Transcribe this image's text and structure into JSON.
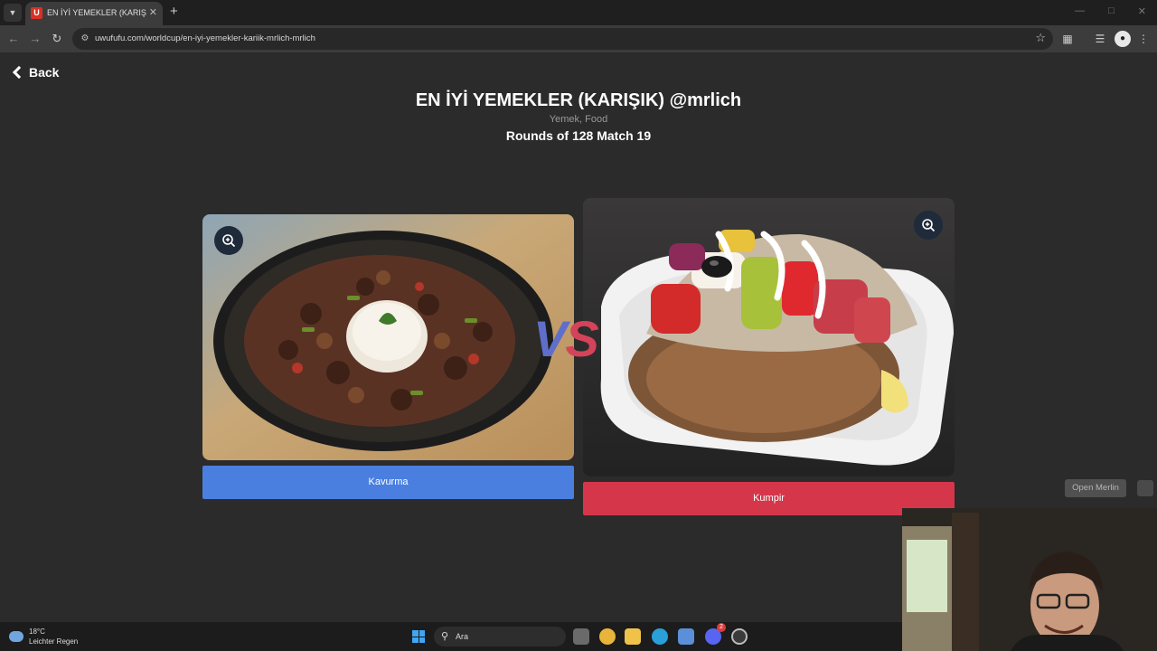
{
  "browser": {
    "tab_title": "EN İYİ YEMEKLER (KARIŞIK) @mrlich",
    "favicon_letter": "U",
    "url": "uwufufu.com/worldcup/en-iyi-yemekler-kariik-mrlich-mrlich"
  },
  "page": {
    "back_label": "Back",
    "title": "EN İYİ YEMEKLER (KARIŞIK) @mrlich",
    "subtitle": "Yemek, Food",
    "round_info": "Rounds of 128 Match 19",
    "vs_v": "V",
    "vs_s": "S"
  },
  "choices": [
    {
      "label": "Kavurma",
      "color": "#4a7fe0"
    },
    {
      "label": "Kumpir",
      "color": "#d5364a"
    }
  ],
  "merlin": {
    "label": "Open Merlin"
  },
  "taskbar": {
    "temperature": "18°C",
    "weather": "Leichter Regen",
    "search_label": "Ara",
    "discord_badge": "2"
  },
  "icons": {
    "back": "chevron-left-icon",
    "zoom": "zoom-in-icon",
    "star": "star-icon"
  }
}
